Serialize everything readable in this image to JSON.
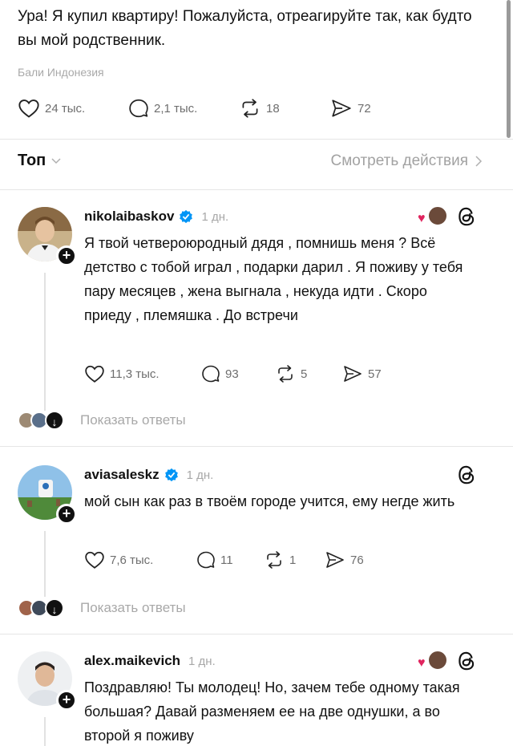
{
  "top_post": {
    "text": "Ура! Я купил квартиру! Пожалуйста, отреагируйте так, как будто вы мой родственник.",
    "location": "Бали Индонезия",
    "likes": "24 тыс.",
    "comments": "2,1 тыс.",
    "reposts": "18",
    "shares": "72"
  },
  "sort_bar": {
    "sort_label": "Топ",
    "view_activity": "Смотреть действия"
  },
  "replies": [
    {
      "username": "nikolaibaskov",
      "time": "1 дн.",
      "text": "Я твой четвероюродный дядя , помнишь меня ? Всё детство с тобой играл , подарки дарил . Я поживу у тебя пару месяцев , жена выгнала , некуда идти . Скоро приеду , племяшка . До встречи",
      "likes": "11,3 тыс.",
      "comments": "93",
      "reposts": "5",
      "shares": "57",
      "show_replies": "Показать ответы"
    },
    {
      "username": "aviasaleskz",
      "time": "1 дн.",
      "text": "мой сын как раз в твоём городе учится, ему негде жить",
      "likes": "7,6 тыс.",
      "comments": "11",
      "reposts": "1",
      "shares": "76",
      "show_replies": "Показать ответы"
    },
    {
      "username": "alex.maikevich",
      "time": "1 дн.",
      "text": "Поздравляю! Ты молодец! Но, зачем тебе одному такая большая? Давай разменяем ее на две однушки, а во второй я поживу"
    }
  ],
  "colors": {
    "verified_blue": "#0095f6",
    "heart_red": "#e0245e",
    "muted_text": "#a8a8a8"
  },
  "icons": {
    "like": "heart-outline-icon",
    "comment": "speech-bubble-icon",
    "repost": "repost-arrows-icon",
    "share": "send-icon",
    "threads": "threads-logo-icon",
    "verified": "verified-badge-icon"
  }
}
